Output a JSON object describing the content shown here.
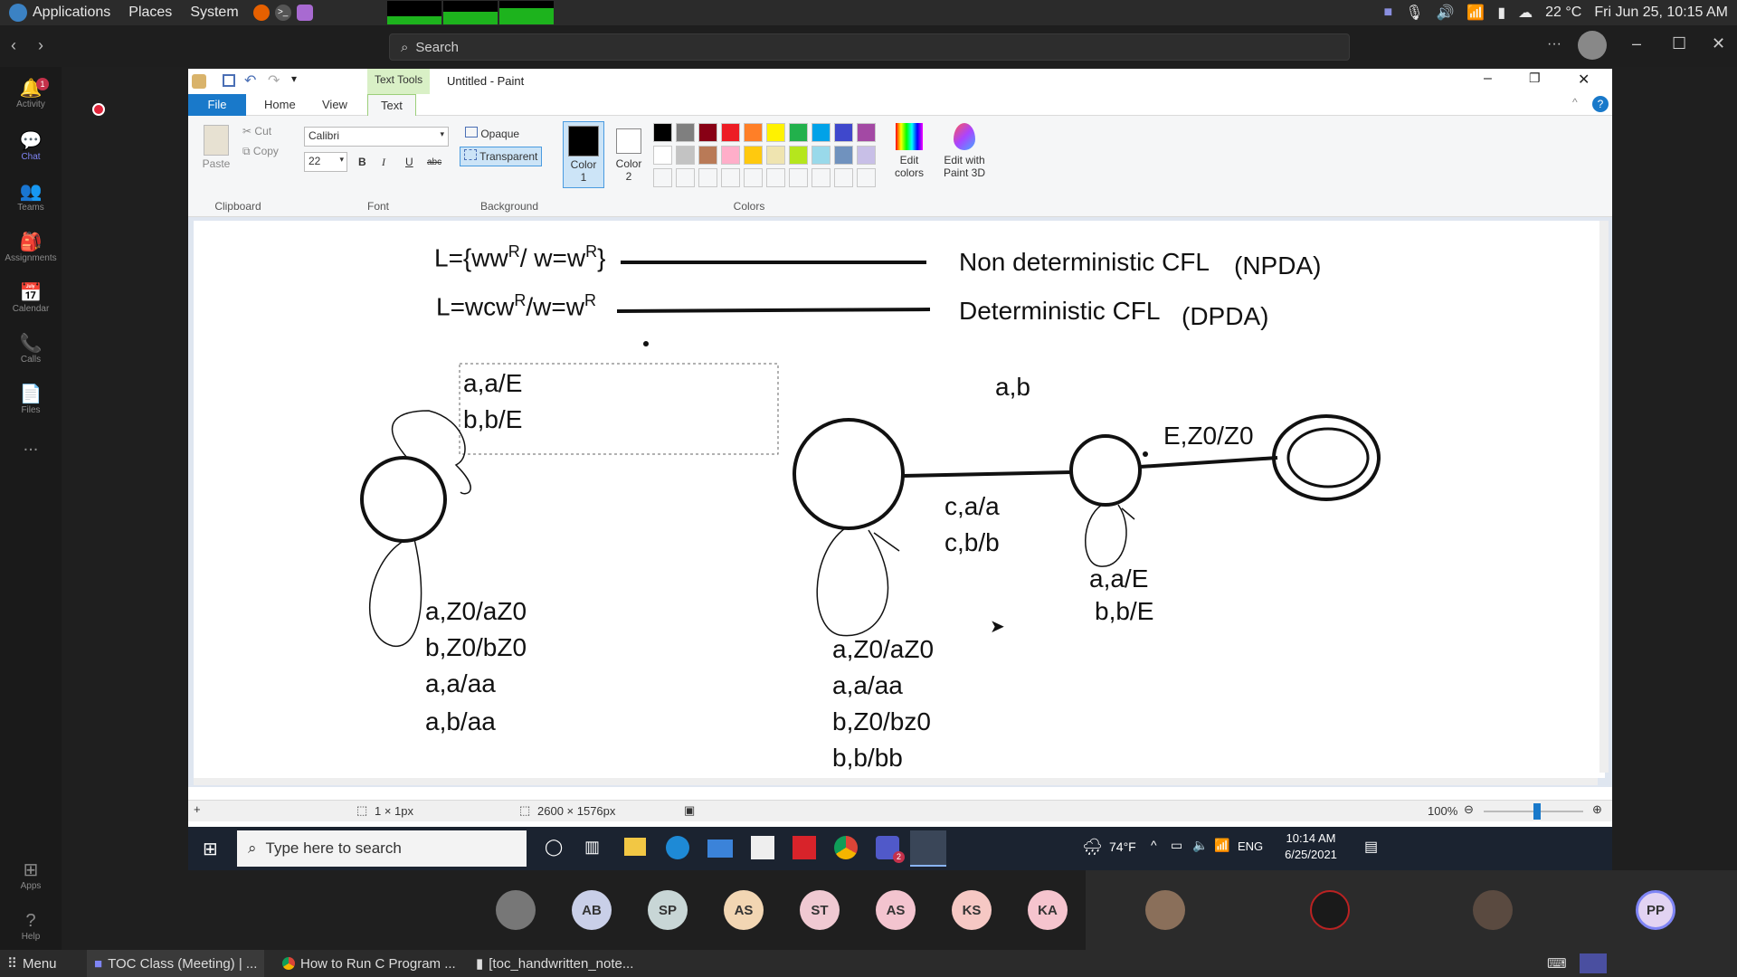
{
  "linux_top": {
    "menu": [
      "Applications",
      "Places",
      "System"
    ],
    "temp": "22 °C",
    "datetime": "Fri Jun 25, 10:15 AM",
    "monitor_levels": [
      0.35,
      0.55,
      0.7
    ]
  },
  "teams": {
    "search_placeholder": "Search",
    "activity_badge": "1",
    "rail": [
      {
        "label": "Activity",
        "icon": "bell-icon"
      },
      {
        "label": "Chat",
        "icon": "chat-icon"
      },
      {
        "label": "Teams",
        "icon": "teams-icon"
      },
      {
        "label": "Assignments",
        "icon": "assignments-icon"
      },
      {
        "label": "Calendar",
        "icon": "calendar-icon"
      },
      {
        "label": "Calls",
        "icon": "phone-icon"
      },
      {
        "label": "Files",
        "icon": "file-icon"
      },
      {
        "label": "...",
        "icon": "more-icon"
      },
      {
        "label": "Apps",
        "icon": "apps-icon"
      },
      {
        "label": "Help",
        "icon": "help-icon"
      }
    ],
    "more_label": "···"
  },
  "paint": {
    "title": "Untitled - Paint",
    "contextual_tab": "Text Tools",
    "tabs": [
      "File",
      "Home",
      "View",
      "Text"
    ],
    "clipboard": {
      "paste": "Paste",
      "cut": "Cut",
      "copy": "Copy",
      "label": "Clipboard"
    },
    "font": {
      "family": "Calibri",
      "size": "22",
      "label": "Font",
      "bold": "B",
      "italic": "I",
      "underline": "U",
      "strike": "abc"
    },
    "background": {
      "opaque": "Opaque",
      "transparent": "Transparent",
      "label": "Background"
    },
    "colors": {
      "color1": "Color\n1",
      "color2": "Color\n2",
      "label": "Colors",
      "edit": "Edit\ncolors",
      "paint3d": "Edit with\nPaint 3D",
      "row1": [
        "#000000",
        "#7f7f7f",
        "#880015",
        "#ed1c24",
        "#ff7f27",
        "#fff200",
        "#22b14c",
        "#00a2e8",
        "#3f48cc",
        "#a349a4"
      ],
      "row2": [
        "#ffffff",
        "#c3c3c3",
        "#b97a57",
        "#ffaec9",
        "#ffc90e",
        "#efe4b0",
        "#b5e61d",
        "#99d9ea",
        "#7092be",
        "#c8bfe7"
      ]
    },
    "canvas": {
      "line1_lang": "L={ww",
      "line1_sup": "R",
      "line1_mid": "/ w=w",
      "line1_sup2": "R",
      "line1_end": "}",
      "line1_desc": "Non deterministic CFL",
      "line1_tag": "(NPDA)",
      "line2_lang": "L=wcw",
      "line2_sup": "R",
      "line2_mid": "/w=w",
      "line2_sup2": "R",
      "line2_desc": "Deterministic CFL",
      "line2_tag": "(DPDA)",
      "sel_text": [
        "a,a/E",
        "b,b/E"
      ],
      "q0_labels": [
        "a,Z0/aZ0",
        "b,Z0/bZ0",
        "a,a/aa",
        "a,b/aa"
      ],
      "ab_label": "a,b",
      "ez_label": "E,Z0/Z0",
      "c_labels": [
        "c,a/a",
        "c,b/b"
      ],
      "q2_loop": [
        "a,a/E",
        "b,b/E"
      ],
      "q1_labels": [
        "a,Z0/aZ0",
        "a,a/aa",
        "b,Z0/bz0",
        "b,b/bb"
      ]
    },
    "status": {
      "cursor": "1 × 1px",
      "size": "2600 × 1576px",
      "zoom": "100%",
      "zoom_level": 0.55
    }
  },
  "win_taskbar": {
    "search": "Type here to search",
    "weather": "74°F",
    "lang": "ENG",
    "time": "10:14 AM",
    "date": "6/25/2021",
    "teams_badge": "2"
  },
  "participants": [
    {
      "initials": "AB",
      "color": "#c9cfe8"
    },
    {
      "initials": "SP",
      "color": "#c8d6d6"
    },
    {
      "initials": "AS",
      "color": "#f2d6b3"
    },
    {
      "initials": "ST",
      "color": "#f0c9d2"
    },
    {
      "initials": "AS",
      "color": "#f3c4cf"
    },
    {
      "initials": "KS",
      "color": "#f6c8c4"
    },
    {
      "initials": "KA",
      "color": "#f5c4ce"
    },
    {
      "initials": "PP",
      "color": "#e2d3f2"
    }
  ],
  "bottom_bar": {
    "menu": "Menu",
    "tasks": [
      "TOC Class (Meeting) | ...",
      "How to Run C Program ...",
      "[toc_handwritten_note..."
    ]
  }
}
